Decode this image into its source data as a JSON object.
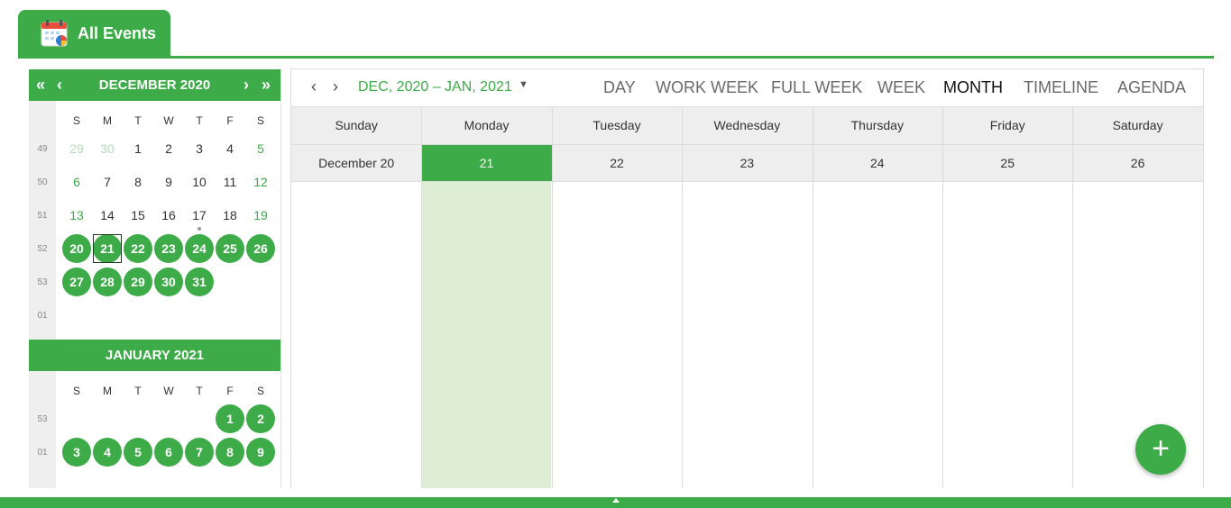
{
  "tab": {
    "label": "All Events",
    "icon": "calendar-icon"
  },
  "colors": {
    "accent": "#3dab48",
    "today_column": "#ddeed5"
  },
  "sidebar": {
    "december": {
      "title": "DECEMBER 2020",
      "dows": [
        "S",
        "M",
        "T",
        "W",
        "T",
        "F",
        "S"
      ],
      "weeks": [
        {
          "num": "49",
          "days": [
            "29",
            "30",
            "1",
            "2",
            "3",
            "4",
            "5"
          ]
        },
        {
          "num": "50",
          "days": [
            "6",
            "7",
            "8",
            "9",
            "10",
            "11",
            "12"
          ]
        },
        {
          "num": "51",
          "days": [
            "13",
            "14",
            "15",
            "16",
            "17",
            "18",
            "19"
          ]
        },
        {
          "num": "52",
          "days": [
            "20",
            "21",
            "22",
            "23",
            "24",
            "25",
            "26"
          ]
        },
        {
          "num": "53",
          "days": [
            "27",
            "28",
            "29",
            "30",
            "31",
            "",
            ""
          ]
        },
        {
          "num": "01",
          "days": [
            "",
            "",
            "",
            "",
            "",
            "",
            ""
          ]
        }
      ]
    },
    "january": {
      "title": "JANUARY 2021",
      "dows": [
        "S",
        "M",
        "T",
        "W",
        "T",
        "F",
        "S"
      ],
      "weeks": [
        {
          "num": "53",
          "days": [
            "",
            "",
            "",
            "",
            "",
            "1",
            "2"
          ]
        },
        {
          "num": "01",
          "days": [
            "3",
            "4",
            "5",
            "6",
            "7",
            "8",
            "9"
          ]
        }
      ]
    }
  },
  "toolbar": {
    "range": "DEC, 2020 – JAN, 2021",
    "views": [
      "DAY",
      "WORK WEEK",
      "FULL WEEK",
      "WEEK",
      "MONTH",
      "TIMELINE",
      "AGENDA"
    ],
    "active_view": "MONTH"
  },
  "grid": {
    "headers": [
      "Sunday",
      "Monday",
      "Tuesday",
      "Wednesday",
      "Thursday",
      "Friday",
      "Saturday"
    ],
    "dates": [
      "December 20",
      "21",
      "22",
      "23",
      "24",
      "25",
      "26"
    ],
    "selected_date": "21"
  }
}
